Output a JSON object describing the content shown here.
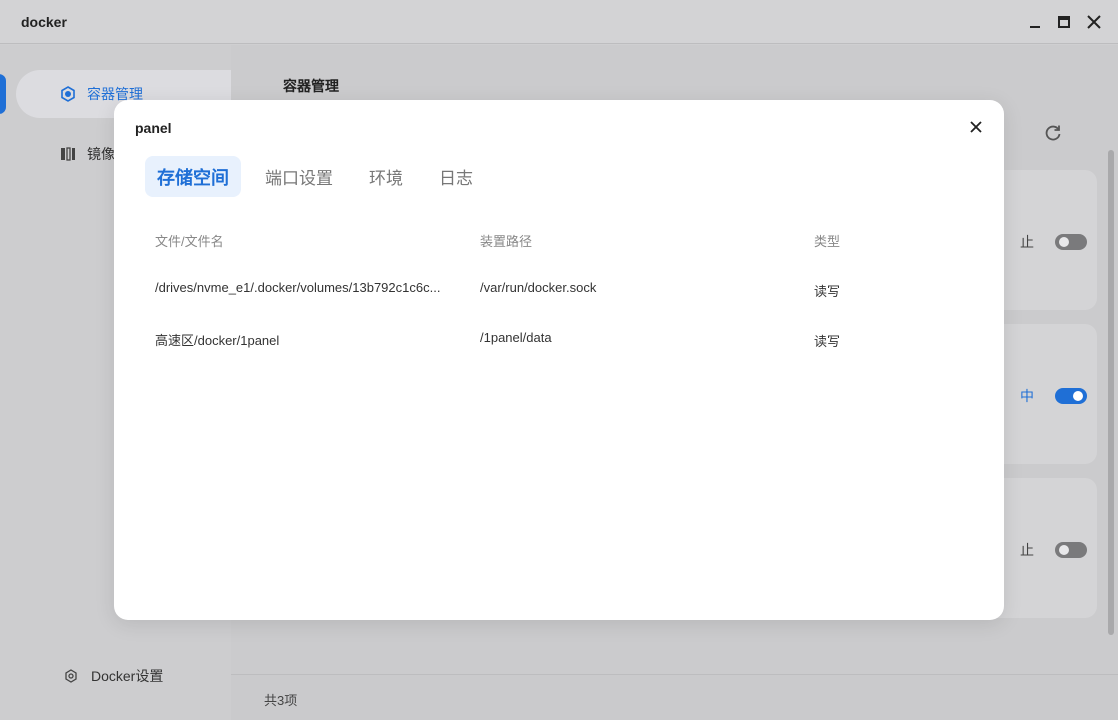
{
  "window": {
    "title": "docker"
  },
  "sidebar": {
    "items": [
      {
        "label": "容器管理",
        "active": true
      },
      {
        "label": "镜像",
        "active": false
      }
    ],
    "settings_label": "Docker设置"
  },
  "main": {
    "title": "容器管理",
    "cards": [
      {
        "status": "止",
        "running": false
      },
      {
        "status": "中",
        "running": true
      },
      {
        "status": "止",
        "running": false
      }
    ],
    "footer_count": "共3项"
  },
  "modal": {
    "title": "panel",
    "tabs": [
      {
        "label": "存储空间",
        "active": true
      },
      {
        "label": "端口设置",
        "active": false
      },
      {
        "label": "环境",
        "active": false
      },
      {
        "label": "日志",
        "active": false
      }
    ],
    "table": {
      "columns": [
        "文件/文件名",
        "装置路径",
        "类型"
      ],
      "rows": [
        [
          "/drives/nvme_e1/.docker/volumes/13b792c1c6c...",
          "/var/run/docker.sock",
          "读写"
        ],
        [
          "高速区/docker/1panel",
          "/1panel/data",
          "读写"
        ]
      ]
    }
  },
  "colors": {
    "accent": "#1f6fd6",
    "tab_active_bg": "#e8f1fd"
  }
}
